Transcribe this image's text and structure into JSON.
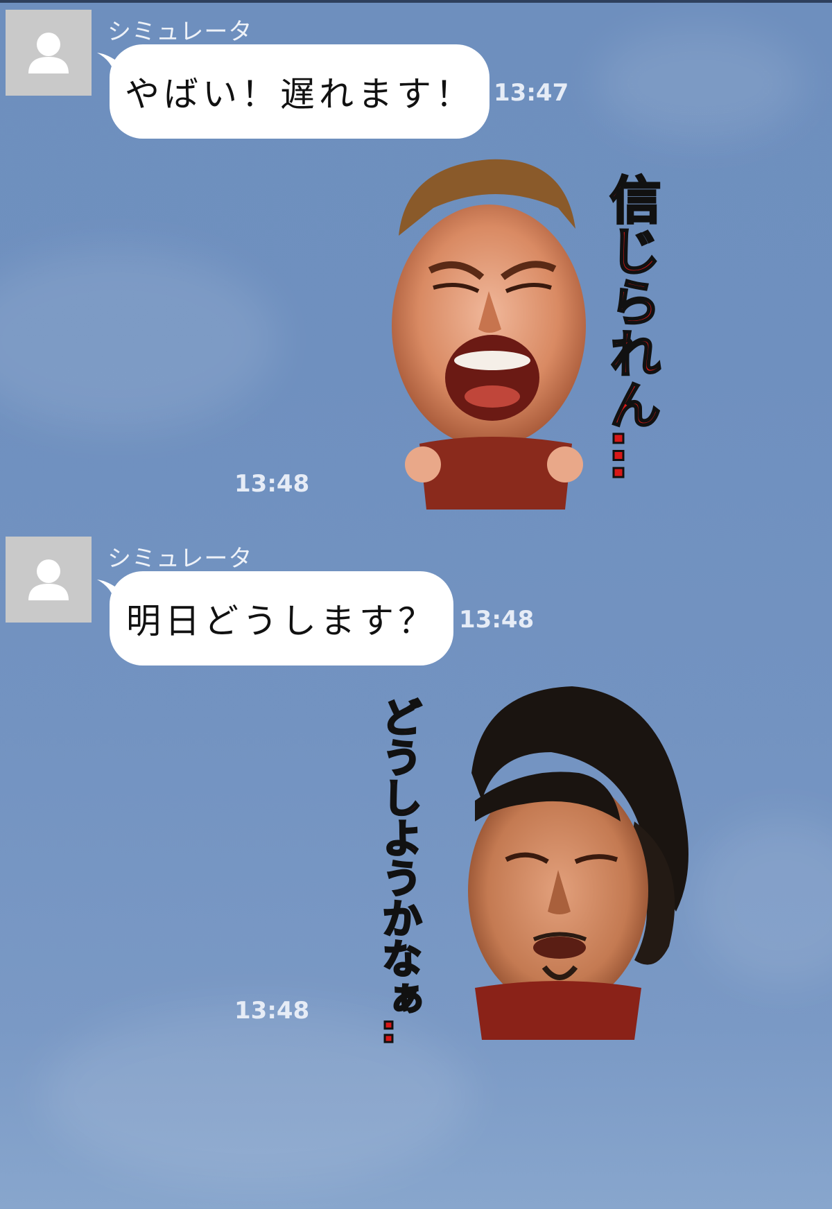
{
  "colors": {
    "background": "#6f90bf",
    "bubble": "#ffffff",
    "meta_text": "#e6ecf6",
    "sticker_red": "#d81818"
  },
  "messages": [
    {
      "type": "text",
      "direction": "incoming",
      "sender": "シミュレータ",
      "avatar_icon": "default-user-icon",
      "text": "やばい！遅れます！",
      "time": "13:47"
    },
    {
      "type": "sticker",
      "direction": "outgoing",
      "sticker": "shouting-wrestler-sticker",
      "caption": "信じられん…",
      "time": "13:48"
    },
    {
      "type": "text",
      "direction": "incoming",
      "sender": "シミュレータ",
      "avatar_icon": "default-user-icon",
      "text": "明日どうします？",
      "time": "13:48"
    },
    {
      "type": "sticker",
      "direction": "outgoing",
      "sticker": "long-haired-wrestler-sticker",
      "caption": "どうしようかなぁ…",
      "time": "13:48"
    }
  ]
}
